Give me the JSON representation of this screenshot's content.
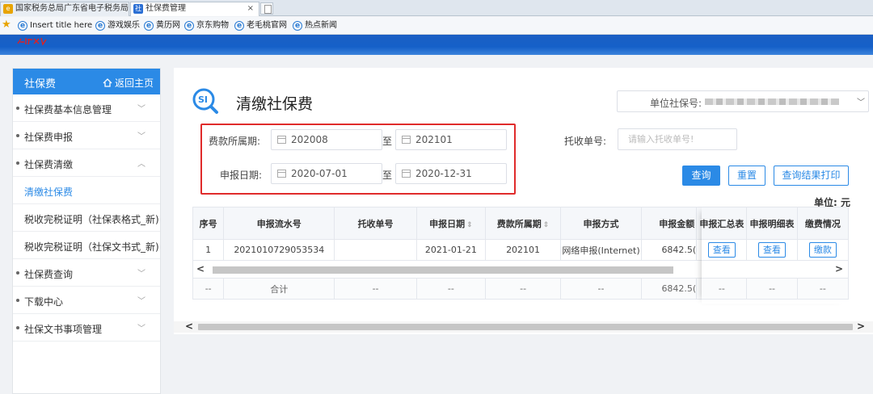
{
  "browser": {
    "tabs": [
      {
        "label": "国家税务总局广东省电子税务局",
        "active": false
      },
      {
        "label": "社保费管理",
        "active": true
      }
    ],
    "close_glyph": "×",
    "bookmarks": [
      {
        "label": "Insert title here"
      },
      {
        "label": "游戏娱乐"
      },
      {
        "label": "黄历网"
      },
      {
        "label": "京东购物"
      },
      {
        "label": "老毛桃官网"
      },
      {
        "label": "热点新闻"
      }
    ]
  },
  "sidebar": {
    "title": "社保费",
    "home_link": "返回主页",
    "items": [
      {
        "label": "社保费基本信息管理",
        "expanded": false
      },
      {
        "label": "社保费申报",
        "expanded": false
      },
      {
        "label": "社保费清缴",
        "expanded": true
      },
      {
        "label": "清缴社保费",
        "sub": true,
        "active": true
      },
      {
        "label": "税收完税证明（社保表格式_新)",
        "sub": true
      },
      {
        "label": "税收完税证明（社保文书式_新)",
        "sub": true
      },
      {
        "label": "社保费查询",
        "expanded": false
      },
      {
        "label": "下载中心",
        "expanded": false
      },
      {
        "label": "社保文书事项管理",
        "expanded": false
      }
    ]
  },
  "page": {
    "title": "清缴社保费",
    "unit_social_no_label": "单位社保号:"
  },
  "form": {
    "fee_period_label": "费款所属期:",
    "fee_period_from": "202008",
    "fee_period_to": "202101",
    "declare_date_label": "申报日期:",
    "declare_date_from": "2020-07-01",
    "declare_date_to": "2020-12-31",
    "to_label": "至",
    "collection_no_label": "托收单号:",
    "collection_no_placeholder": "请输入托收单号!"
  },
  "buttons": {
    "query": "查询",
    "reset": "重置",
    "print": "查询结果打印"
  },
  "unit_text": "单位: 元",
  "table": {
    "headers": [
      "序号",
      "申报流水号",
      "托收单号",
      "申报日期",
      "费款所属期",
      "申报方式",
      "申报金额",
      "申报汇总表",
      "申报明细表",
      "缴费情况"
    ],
    "rows": [
      {
        "no": "1",
        "serial": "2021010729053534",
        "collection": "",
        "date": "2021-01-21",
        "period": "202101",
        "method": "网络申报(Internet)",
        "amount": "6842.5(",
        "summary": "查看",
        "detail": "查看",
        "status": "缴款"
      }
    ],
    "sum_row": {
      "no": "--",
      "serial": "合计",
      "collection": "--",
      "date": "--",
      "period": "--",
      "method": "--",
      "amount": "6842.5(",
      "summary": "--",
      "detail": "--",
      "status": "--"
    }
  },
  "colors": {
    "primary": "#2b8ae6",
    "highlight_border": "#e02b2b",
    "header_blue": "#1560c8"
  }
}
